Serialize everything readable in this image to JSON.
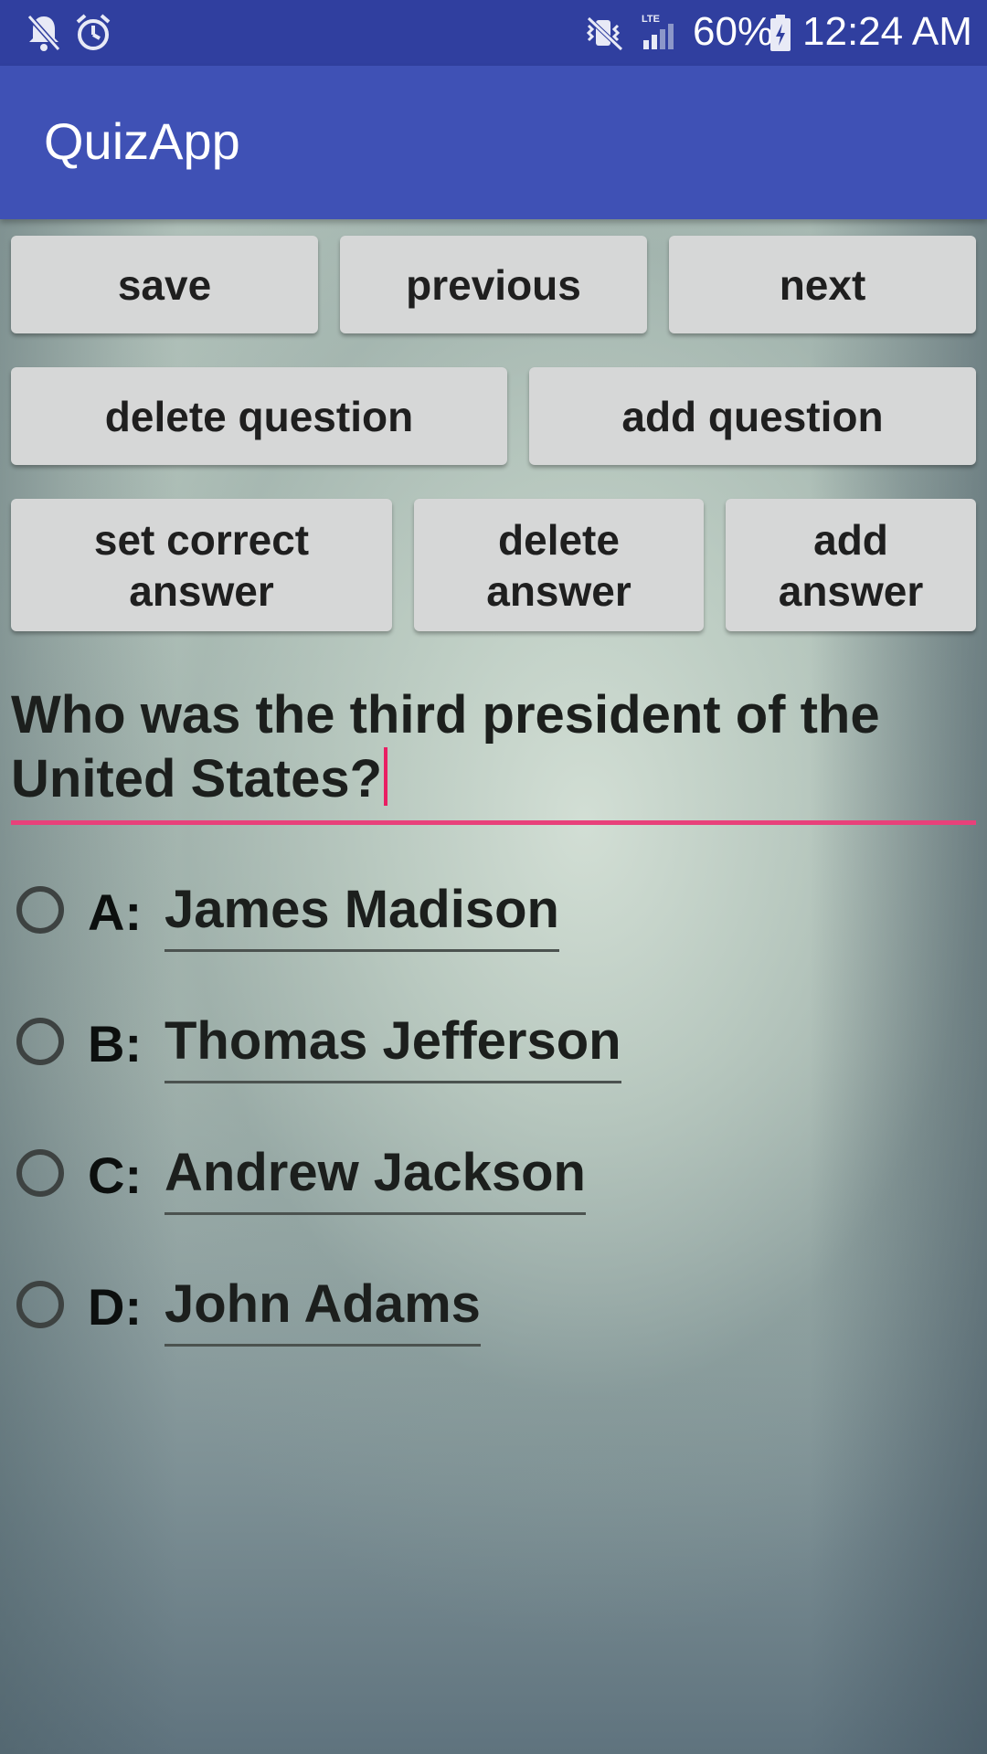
{
  "status_bar": {
    "battery": "60%",
    "time": "12:24 AM",
    "network": "LTE",
    "icons": [
      "notifications-off-icon",
      "alarm-icon",
      "vibrate-mute-icon",
      "signal-icon",
      "battery-charging-icon"
    ]
  },
  "app_bar": {
    "title": "QuizApp"
  },
  "buttons": {
    "save": "save",
    "previous": "previous",
    "next": "next",
    "delete_question": "delete question",
    "add_question": "add question",
    "set_correct_answer": "set correct answer",
    "delete_answer": "delete answer",
    "add_answer": "add answer"
  },
  "question": {
    "text": "Who was the third president of the United States?"
  },
  "answers": [
    {
      "letter": "A:",
      "text": "James Madison",
      "selected": false
    },
    {
      "letter": "B:",
      "text": "Thomas Jefferson",
      "selected": false
    },
    {
      "letter": "C:",
      "text": "Andrew Jackson",
      "selected": false
    },
    {
      "letter": "D:",
      "text": "John Adams",
      "selected": false
    }
  ],
  "colors": {
    "status_bar": "#303f9f",
    "app_bar": "#3f51b5",
    "accent": "#e91e63",
    "button_bg": "#d6d7d7"
  }
}
